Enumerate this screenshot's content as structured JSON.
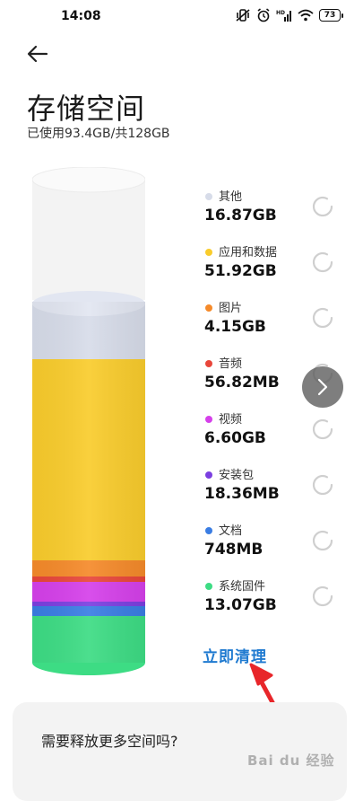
{
  "status_bar": {
    "time": "14:08",
    "battery": "73"
  },
  "header": {
    "title": "存储空间",
    "usage_summary": "已使用93.4GB/共128GB"
  },
  "colors": {
    "other": "#d7dce9",
    "apps_data": "#f9cc2c",
    "images": "#f58a2a",
    "audio": "#e8463a",
    "video": "#d540ea",
    "apk": "#7b3fe0",
    "documents": "#3a7de3",
    "system": "#3ddc84",
    "free": "#f4f4f4",
    "accent": "#1f7ad0"
  },
  "legend": [
    {
      "label": "其他",
      "size": "16.87GB",
      "color": "#d7dce9"
    },
    {
      "label": "应用和数据",
      "size": "51.92GB",
      "color": "#f9cc2c"
    },
    {
      "label": "图片",
      "size": "4.15GB",
      "color": "#f58a2a"
    },
    {
      "label": "音频",
      "size": "56.82MB",
      "color": "#e8463a"
    },
    {
      "label": "视频",
      "size": "6.60GB",
      "color": "#d540ea"
    },
    {
      "label": "安装包",
      "size": "18.36MB",
      "color": "#7b3fe0"
    },
    {
      "label": "文档",
      "size": "748MB",
      "color": "#3a7de3"
    },
    {
      "label": "系统固件",
      "size": "13.07GB",
      "color": "#3ddc84"
    }
  ],
  "actions": {
    "clean_now": "立即清理"
  },
  "suggestion": {
    "text": "需要释放更多空间吗?"
  },
  "watermark": "Bai du 经验"
}
